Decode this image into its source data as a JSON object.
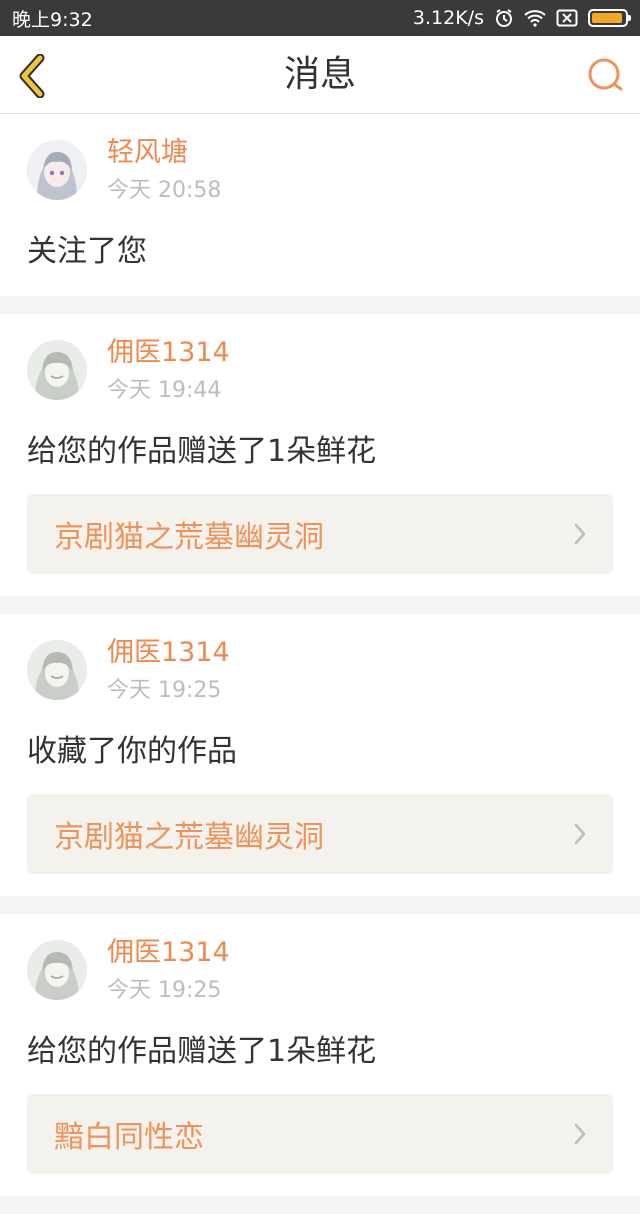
{
  "status_bar": {
    "time": "晚上9:32",
    "network_speed": "3.12K/s",
    "icons": [
      "alarm-icon",
      "wifi-icon",
      "sim-off-icon",
      "battery-icon"
    ],
    "battery_level": 0.95
  },
  "header": {
    "title": "消息",
    "back_icon": "chevron-left-icon",
    "search_icon": "search-icon"
  },
  "colors": {
    "accent": "#ef8a4f",
    "back_icon": "#f2c43b",
    "link_bg": "#f4f2ec"
  },
  "messages": [
    {
      "username": "轻风塘",
      "time": "今天 20:58",
      "text": "关注了您"
    },
    {
      "username": "佣医1314",
      "time": "今天 19:44",
      "text": "给您的作品赠送了1朵鲜花",
      "work_title": "京剧猫之荒墓幽灵洞"
    },
    {
      "username": "佣医1314",
      "time": "今天 19:25",
      "text": "收藏了你的作品",
      "work_title": "京剧猫之荒墓幽灵洞"
    },
    {
      "username": "佣医1314",
      "time": "今天 19:25",
      "text": "给您的作品赠送了1朵鲜花",
      "work_title": "黯白同性恋"
    }
  ]
}
